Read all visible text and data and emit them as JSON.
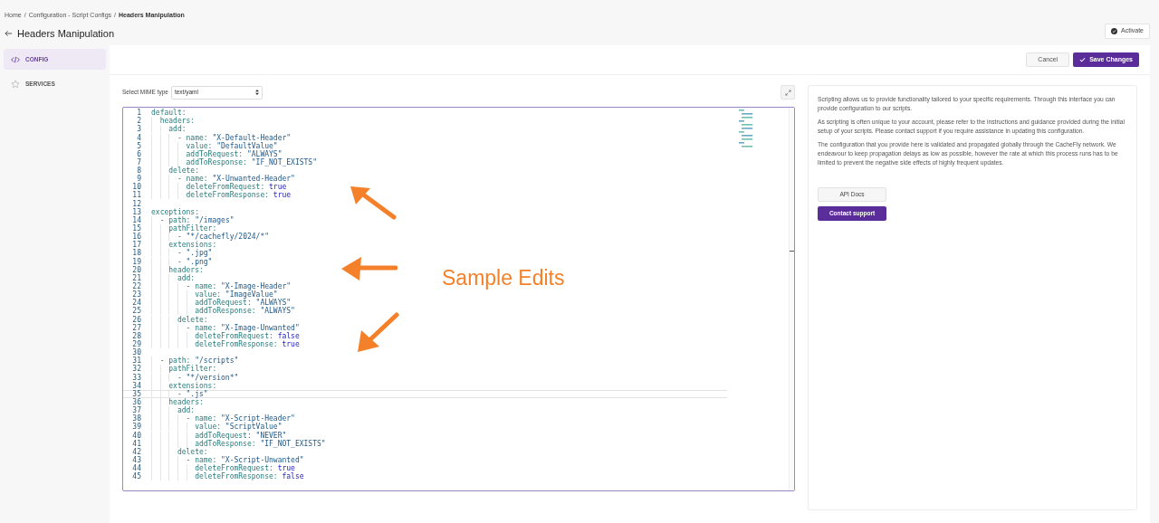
{
  "breadcrumb": [
    {
      "text": "Home",
      "kind": "link"
    },
    {
      "text": "/",
      "kind": "separator"
    },
    {
      "text": "Configuration - Script Configs",
      "kind": "link"
    },
    {
      "text": "/",
      "kind": "separator"
    },
    {
      "text": "Headers Manipulation",
      "kind": "current"
    }
  ],
  "title": "Headers Manipulation",
  "activate_button": "Activate",
  "sidebar": {
    "items": [
      {
        "label": "CONFIG",
        "kind": "code",
        "selected": true
      },
      {
        "label": "SERVICES",
        "kind": "star",
        "selected": false
      }
    ]
  },
  "toolbar": {
    "cancel": "Cancel",
    "save": "Save Changes"
  },
  "mime": {
    "label": "Select MIME type",
    "value": "text/yaml"
  },
  "editor": {
    "lines": [
      {
        "number": "1",
        "code": "default:",
        "current": false
      },
      {
        "number": "2",
        "code": "  headers:",
        "current": false
      },
      {
        "number": "3",
        "code": "    add:",
        "current": false
      },
      {
        "number": "4",
        "code": "      - name: \"X-Default-Header\"",
        "current": false
      },
      {
        "number": "5",
        "code": "        value: \"DefaultValue\"",
        "current": false
      },
      {
        "number": "6",
        "code": "        addToRequest: \"ALWAYS\"",
        "current": false
      },
      {
        "number": "7",
        "code": "        addToResponse: \"IF_NOT_EXISTS\"",
        "current": false
      },
      {
        "number": "8",
        "code": "    delete:",
        "current": false
      },
      {
        "number": "9",
        "code": "      - name: \"X-Unwanted-Header\"",
        "current": false
      },
      {
        "number": "10",
        "code": "        deleteFromRequest: true",
        "current": false
      },
      {
        "number": "11",
        "code": "        deleteFromResponse: true",
        "current": false
      },
      {
        "number": "12",
        "current": false
      },
      {
        "number": "13",
        "code": "exceptions:",
        "current": false
      },
      {
        "number": "14",
        "code": "  - path: \"/images\"",
        "current": false
      },
      {
        "number": "15",
        "code": "    pathFilter:",
        "current": false
      },
      {
        "number": "16",
        "code": "      - \"*/cachefly/2024/*\"",
        "current": false
      },
      {
        "number": "17",
        "code": "    extensions:",
        "current": false
      },
      {
        "number": "18",
        "code": "      - \".jpg\"",
        "current": false
      },
      {
        "number": "19",
        "code": "      - \".png\"",
        "current": false
      },
      {
        "number": "20",
        "code": "    headers:",
        "current": false
      },
      {
        "number": "21",
        "code": "      add:",
        "current": false
      },
      {
        "number": "22",
        "code": "        - name: \"X-Image-Header\"",
        "current": false
      },
      {
        "number": "23",
        "code": "          value: \"ImageValue\"",
        "current": false
      },
      {
        "number": "24",
        "code": "          addToRequest: \"ALWAYS\"",
        "current": false
      },
      {
        "number": "25",
        "code": "          addToResponse: \"ALWAYS\"",
        "current": false
      },
      {
        "number": "26",
        "code": "      delete:",
        "current": false
      },
      {
        "number": "27",
        "code": "        - name: \"X-Image-Unwanted\"",
        "current": false
      },
      {
        "number": "28",
        "code": "          deleteFromRequest: false",
        "current": false
      },
      {
        "number": "29",
        "code": "          deleteFromResponse: true",
        "current": false
      },
      {
        "number": "30",
        "current": false
      },
      {
        "number": "31",
        "code": "  - path: \"/scripts\"",
        "current": false
      },
      {
        "number": "32",
        "code": "    pathFilter:",
        "current": false
      },
      {
        "number": "33",
        "code": "      - \"*/version*\"",
        "current": false
      },
      {
        "number": "34",
        "code": "    extensions:",
        "current": false
      },
      {
        "number": "35",
        "code": "      - \".js\"",
        "current": true
      },
      {
        "number": "36",
        "code": "    headers:",
        "current": false
      },
      {
        "number": "37",
        "code": "      add:",
        "current": false
      },
      {
        "number": "38",
        "code": "        - name: \"X-Script-Header\"",
        "current": false
      },
      {
        "number": "39",
        "code": "          value: \"ScriptValue\"",
        "current": false
      },
      {
        "number": "40",
        "code": "          addToRequest: \"NEVER\"",
        "current": false
      },
      {
        "number": "41",
        "code": "          addToResponse: \"IF_NOT_EXISTS\"",
        "current": false
      },
      {
        "number": "42",
        "code": "      delete:",
        "current": false
      },
      {
        "number": "43",
        "code": "        - name: \"X-Script-Unwanted\"",
        "current": false
      },
      {
        "number": "44",
        "code": "          deleteFromRequest: true",
        "current": false
      },
      {
        "number": "45",
        "code": "          deleteFromResponse: false",
        "current": false
      }
    ]
  },
  "annotation": {
    "text": "Sample Edits"
  },
  "info": {
    "paragraphs": [
      "Scripting allows us to provide functionality tailored to your specific requirements. Through this interface you can provide configuration to our scripts.",
      "As scripting is often unique to your account, please refer to the instructions and guidance provided during the initial setup of your scripts. Please contact support if you require assistance in updating this configuration.",
      "The configuration that you provide here is validated and propagated globally through the CacheFly network. We endeavour to keep propagation delays as low as possible, however the rate at which this process runs has to be limited to prevent the negative side effects of highly frequent updates."
    ],
    "docs_button": "API Docs",
    "support_button": "Contact support"
  }
}
